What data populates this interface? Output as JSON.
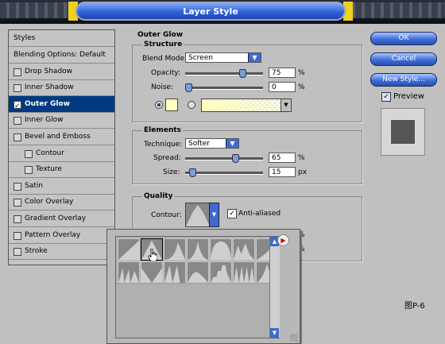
{
  "window": {
    "title": "Layer Style"
  },
  "styles_panel": {
    "header": "Styles",
    "items": [
      {
        "label": "Blending Options: Default",
        "checkbox": false,
        "checked": false,
        "selected": false,
        "sub": false
      },
      {
        "label": "Drop Shadow",
        "checkbox": true,
        "checked": false,
        "selected": false,
        "sub": false
      },
      {
        "label": "Inner Shadow",
        "checkbox": true,
        "checked": false,
        "selected": false,
        "sub": false
      },
      {
        "label": "Outer Glow",
        "checkbox": true,
        "checked": true,
        "selected": true,
        "sub": false
      },
      {
        "label": "Inner Glow",
        "checkbox": true,
        "checked": false,
        "selected": false,
        "sub": false
      },
      {
        "label": "Bevel and Emboss",
        "checkbox": true,
        "checked": false,
        "selected": false,
        "sub": false
      },
      {
        "label": "Contour",
        "checkbox": true,
        "checked": false,
        "selected": false,
        "sub": true
      },
      {
        "label": "Texture",
        "checkbox": true,
        "checked": false,
        "selected": false,
        "sub": true
      },
      {
        "label": "Satin",
        "checkbox": true,
        "checked": false,
        "selected": false,
        "sub": false
      },
      {
        "label": "Color Overlay",
        "checkbox": true,
        "checked": false,
        "selected": false,
        "sub": false
      },
      {
        "label": "Gradient Overlay",
        "checkbox": true,
        "checked": false,
        "selected": false,
        "sub": false
      },
      {
        "label": "Pattern Overlay",
        "checkbox": true,
        "checked": false,
        "selected": false,
        "sub": false
      },
      {
        "label": "Stroke",
        "checkbox": true,
        "checked": false,
        "selected": false,
        "sub": false
      }
    ]
  },
  "outer_glow": {
    "title": "Outer Glow",
    "structure": {
      "title": "Structure",
      "blend_mode_label": "Blend Mode:",
      "blend_mode_value": "Screen",
      "opacity_label": "Opacity:",
      "opacity_value": "75",
      "opacity_unit": "%",
      "opacity_level": 0.75,
      "noise_label": "Noise:",
      "noise_value": "0",
      "noise_unit": "%",
      "noise_level": 0,
      "glow_color": "#ffffbe"
    },
    "elements": {
      "title": "Elements",
      "technique_label": "Technique:",
      "technique_value": "Softer",
      "spread_label": "Spread:",
      "spread_value": "65",
      "spread_unit": "%",
      "spread_level": 0.65,
      "size_label": "Size:",
      "size_value": "15",
      "size_unit": "px",
      "size_level": 0.06
    },
    "quality": {
      "title": "Quality",
      "contour_label": "Contour:",
      "anti_aliased_label": "Anti-aliased",
      "anti_aliased_checked": true,
      "hidden_unit_1": "%",
      "hidden_unit_2": "%"
    }
  },
  "buttons": {
    "ok": "OK",
    "cancel": "Cancel",
    "new_style": "New Style...",
    "preview": "Preview"
  },
  "preview_checked": true,
  "caption": "图P-6",
  "contour_presets": [
    "linear",
    "cone",
    "cove-deep",
    "gaussian",
    "half-round",
    "ring",
    "rolling-slope",
    "sawtooth",
    "cone-inverted",
    "ring-double",
    "cove-shallow",
    "rounded-steps",
    "ring-triple",
    "peak"
  ],
  "colors": {
    "accent": "#3e6ad0",
    "selected_row": "#003a80",
    "panel": "#c0c0c0"
  }
}
